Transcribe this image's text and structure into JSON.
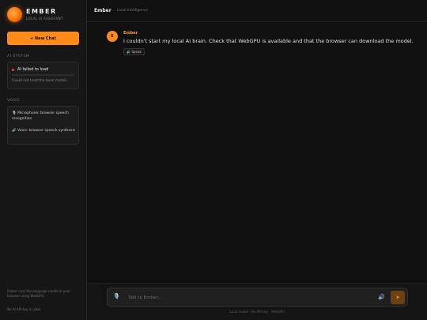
{
  "brand": {
    "title": "EMBER",
    "subtitle": "LOCAL AI ASSISTANT"
  },
  "sidebar": {
    "new_chat_label": "+ New Chat",
    "ai_system": {
      "label": "AI SYSTEM",
      "status": "AI failed to load",
      "detail": "Could not load the local model.",
      "progress": 0
    },
    "voice": {
      "label": "VOICE",
      "microphone": "🎙️ Microphone: browser speech recognition",
      "synthesis": "🔊 Voice: browser speech synthesis"
    },
    "footer_note_1": "Ember runs the language model in your browser using WebGPU.",
    "footer_note_2": "No AI API key is used."
  },
  "header": {
    "title": "Ember",
    "subtitle": "Local Intelligence"
  },
  "messages": [
    {
      "avatar": "E",
      "author": "Ember",
      "text": "I couldn't start my local AI brain. Check that WebGPU is available and that the browser can download the model.",
      "speak_label": "🔊 Speak"
    }
  ],
  "composer": {
    "placeholder": "Talk to Ember...",
    "mic_icon": "🎙️",
    "speaker_icon": "🔊",
    "send_icon": "➤",
    "note": "Local model · No API key · WebGPU"
  },
  "colors": {
    "accent": "#ff8a1a",
    "error": "#e0443a",
    "background": "#0e0e0e"
  }
}
